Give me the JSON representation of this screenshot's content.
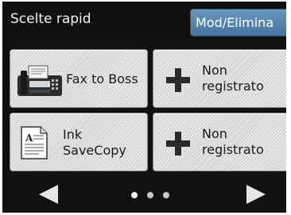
{
  "header": {
    "title": "Scelte rapid",
    "edit_label": "Mod/Elimina"
  },
  "tiles": [
    {
      "label": "Fax to Boss",
      "icon": "fax-machine-icon"
    },
    {
      "label": "Non\nregistrato",
      "icon": "plus-icon"
    },
    {
      "label": "Ink\nSaveCopy",
      "icon": "document-icon"
    },
    {
      "label": "Non\nregistrato",
      "icon": "plus-icon"
    }
  ],
  "pager": {
    "page_count": 3,
    "current_page": 1,
    "active_dot_color": "#ffffff",
    "inactive_dot_color": "#c8c8c8"
  },
  "colors": {
    "background": "#111111",
    "edit_button": "#5a87b0",
    "tile": "#e4e4e4"
  }
}
